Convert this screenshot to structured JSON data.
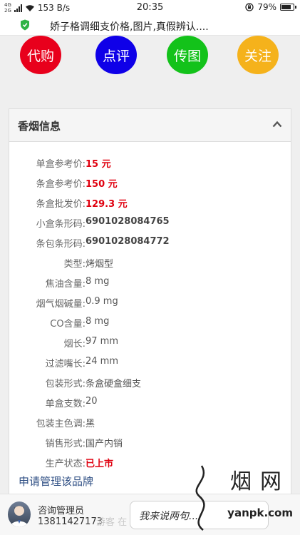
{
  "status_bar": {
    "signal_top": "4G",
    "signal_bottom": "2G",
    "speed": "153 B/s",
    "time": "20:35",
    "battery": "79%"
  },
  "browser": {
    "page_title": "娇子格调细支价格,图片,真假辨认...."
  },
  "actions": [
    {
      "label": "代购",
      "color": "#e8001c"
    },
    {
      "label": "点评",
      "color": "#0f00e8"
    },
    {
      "label": "传图",
      "color": "#13c21a"
    },
    {
      "label": "关注",
      "color": "#f5b21b"
    }
  ],
  "card": {
    "title": "香烟信息",
    "rows": [
      {
        "label": "单盒参考价:",
        "value": "15 元"
      },
      {
        "label": "条盒参考价:",
        "value": "150 元"
      },
      {
        "label": "条盒批发价:",
        "value": "129.3 元"
      },
      {
        "label": "小盒条形码:",
        "value": "6901028084765"
      },
      {
        "label": "条包条形码:",
        "value": "6901028084772"
      },
      {
        "label": "类型:",
        "value": "烤烟型"
      },
      {
        "label": "焦油含量:",
        "value": "8 mg"
      },
      {
        "label": "烟气烟碱量:",
        "value": "0.9 mg"
      },
      {
        "label": "CO含量:",
        "value": "8 mg"
      },
      {
        "label": "烟长:",
        "value": "97 mm"
      },
      {
        "label": "过滤嘴长:",
        "value": "24 mm"
      },
      {
        "label": "包装形式:",
        "value": "条盒硬盒细支"
      },
      {
        "label": "单盒支数:",
        "value": "20"
      },
      {
        "label": "包装主色调:",
        "value": "黑"
      },
      {
        "label": "销售形式:",
        "value": "国产内销"
      },
      {
        "label": "生产状态:",
        "value": "已上市"
      }
    ],
    "apply_link": "申请管理该品牌"
  },
  "bottom": {
    "admin_label": "咨询管理员",
    "admin_phone": "13811427173",
    "ghost_text": "游客 在",
    "comment_placeholder": "我来说两句...",
    "watermark_top": "烟网",
    "watermark_url": "yanpk.com"
  },
  "colors": {
    "price_red": "#e0000f",
    "link_blue": "#2f4f84"
  }
}
